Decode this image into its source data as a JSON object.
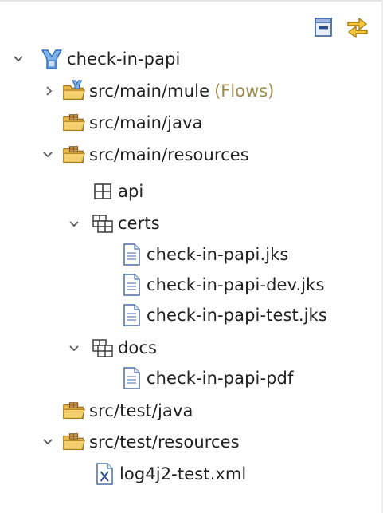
{
  "toolbar": {
    "collapse_icon": "collapse-all-icon",
    "link_icon": "link-with-editor-icon"
  },
  "colors": {
    "folder": "#e8b84a",
    "folder_dark": "#b9862a",
    "mule_blue": "#2f7fd1",
    "file_blue": "#5b7bb8",
    "decoration": "#9b8a4a"
  },
  "tree": {
    "project": {
      "label": "check-in-papi",
      "icon": "mule-project-icon",
      "state": "expanded"
    },
    "src_main_mule": {
      "label": "src/main/mule",
      "decoration": "(Flows)",
      "icon": "mule-source-folder-icon",
      "state": "collapsed"
    },
    "src_main_java": {
      "label": "src/main/java",
      "icon": "source-folder-icon"
    },
    "src_main_resources": {
      "label": "src/main/resources",
      "icon": "source-folder-icon",
      "state": "expanded"
    },
    "api": {
      "label": "api",
      "icon": "package-icon"
    },
    "certs": {
      "label": "certs",
      "icon": "package-icon",
      "state": "expanded"
    },
    "certs_file_1": {
      "label": "check-in-papi.jks",
      "icon": "file-icon"
    },
    "certs_file_2": {
      "label": "check-in-papi-dev.jks",
      "icon": "file-icon"
    },
    "certs_file_3": {
      "label": "check-in-papi-test.jks",
      "icon": "file-icon"
    },
    "docs": {
      "label": "docs",
      "icon": "package-icon",
      "state": "expanded"
    },
    "docs_file_1": {
      "label": "check-in-papi-pdf",
      "icon": "file-icon"
    },
    "src_test_java": {
      "label": "src/test/java",
      "icon": "source-folder-icon"
    },
    "src_test_resources": {
      "label": "src/test/resources",
      "icon": "source-folder-icon",
      "state": "expanded"
    },
    "log4j2": {
      "label": "log4j2-test.xml",
      "icon": "xml-file-icon"
    }
  }
}
